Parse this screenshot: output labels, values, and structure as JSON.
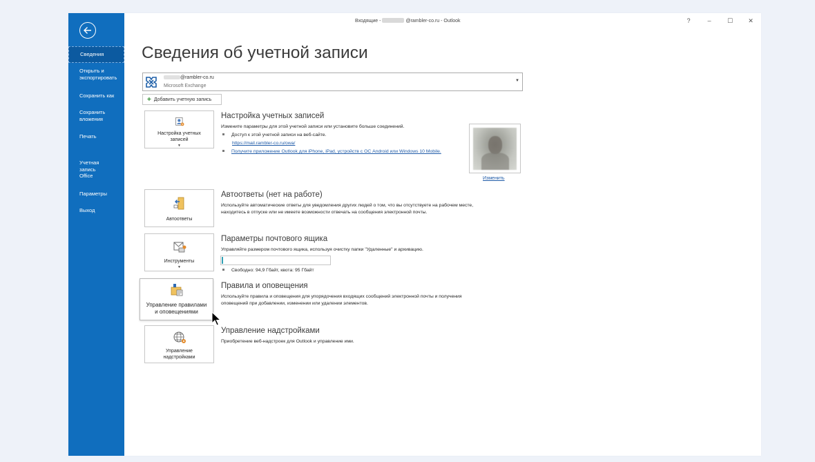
{
  "window": {
    "title_prefix": "Входящие -",
    "title_suffix": "@rambler-co.ru  -  Outlook",
    "controls": [
      "?",
      "–",
      "☐",
      "✕"
    ]
  },
  "sidebar": {
    "items": [
      {
        "label": "Сведения",
        "active": true
      },
      {
        "label": "Открыть и экспортировать"
      },
      {
        "label": "Сохранить как"
      },
      {
        "label": "Сохранить вложения"
      },
      {
        "label": "Печать"
      },
      {
        "label": "Учетная запись Office"
      },
      {
        "label": "Параметры"
      },
      {
        "label": "Выход"
      }
    ]
  },
  "page_title": "Сведения об учетной записи",
  "account": {
    "email_suffix": "@rambler-co.ru",
    "type": "Microsoft Exchange"
  },
  "add_account_label": "Добавить учетную запись",
  "sections": {
    "account_settings": {
      "tile_label": "Настройка учетных\nзаписей",
      "title": "Настройка учетных записей",
      "desc": "Измените параметры для этой учетной записи или установите больше соединений.",
      "bullet1": "Доступ к этой учетной записи на веб-сайте.",
      "link1": "https://mail.rambler-co.ru/owa/",
      "link2": "Получите приложение Outlook для iPhone, iPad, устройств с ОС Android или Windows 10 Mobile.",
      "change_link": "Изменить"
    },
    "auto_reply": {
      "tile_label": "Автоответы",
      "title": "Автоответы (нет на работе)",
      "desc_line1": "Используйте автоматические ответы для уведомления других людей о том, что вы отсутствуете на рабочем месте,",
      "desc_line2": "находитесь в отпуске или не имеете возможности отвечать на сообщения электронной почты."
    },
    "mailbox": {
      "tile_label": "Инструменты",
      "title": "Параметры почтового ящика",
      "desc": "Управляйте размером почтового ящика, используя очистку папки \"Удаленные\" и архивацию.",
      "quota_text": "Свободно: 94,9 Гбайт, квота: 95 Гбайт",
      "quota_used_fraction": 0.01
    },
    "rules": {
      "tile_label": "Управление правилами\nи оповещениями",
      "title": "Правила и оповещения",
      "desc_line1": "Используйте правила и оповещения для упорядочения входящих сообщений электронной почты и получения",
      "desc_line2": "оповещений при добавлении, изменении или удалении элементов."
    },
    "addins": {
      "tile_label": "Управление\nнадстройками",
      "title": "Управление надстройками",
      "desc": "Приобретение веб-надстроек для Outlook и управление ими."
    }
  },
  "colors": {
    "sidebar": "#106ebe",
    "link": "#1f5ba8",
    "quota_fill": "#31a1b5"
  }
}
